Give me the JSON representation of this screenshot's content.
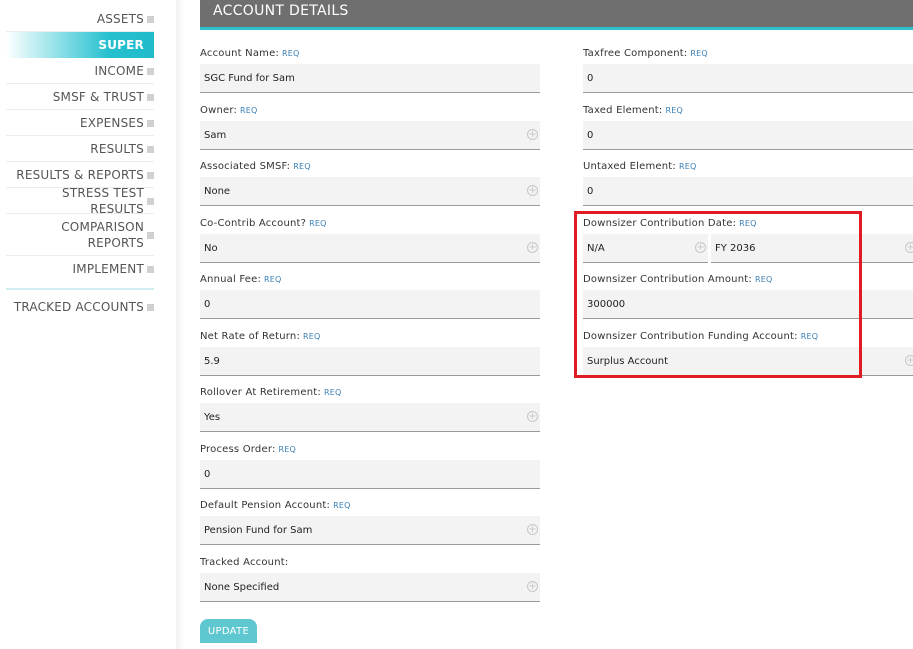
{
  "sidebar": {
    "items": [
      {
        "label": "ASSETS"
      },
      {
        "label": "SUPER"
      },
      {
        "label": "INCOME"
      },
      {
        "label": "SMSF & TRUST"
      },
      {
        "label": "EXPENSES"
      },
      {
        "label": "RESULTS"
      },
      {
        "label": "RESULTS & REPORTS"
      },
      {
        "label": "STRESS TEST RESULTS"
      },
      {
        "label_line1": "COMPARISON",
        "label_line2": "REPORTS"
      },
      {
        "label": "IMPLEMENT"
      },
      {
        "label": "TRACKED ACCOUNTS"
      }
    ],
    "active": "SUPER",
    "accent_color": "#21bccb"
  },
  "header": {
    "title": "ACCOUNT DETAILS",
    "bg_color": "#6f6f6f",
    "underline_color": "#2fc1ce"
  },
  "req_label": "REQ",
  "left_fields": [
    {
      "label": "Account Name:",
      "value": "SGC Fund for Sam",
      "req": true
    },
    {
      "label": "Owner:",
      "value": "Sam",
      "req": true
    },
    {
      "label": "Associated SMSF:",
      "value": "None",
      "req": true
    },
    {
      "label": "Co-Contrib Account?",
      "value": "No",
      "req": true
    },
    {
      "label": "Annual Fee:",
      "value": "0",
      "req": true
    },
    {
      "label": "Net Rate of Return:",
      "value": "5.9",
      "req": true
    },
    {
      "label": "Rollover At Retirement:",
      "value": "Yes",
      "req": true
    },
    {
      "label": "Process Order:",
      "value": "0",
      "req": true
    },
    {
      "label": "Default Pension Account:",
      "value": "Pension Fund for Sam",
      "req": true
    },
    {
      "label": "Tracked Account:",
      "value": "None Specified",
      "req": false
    }
  ],
  "right_fields": [
    {
      "label": "Taxfree Component:",
      "value": "0",
      "req": true
    },
    {
      "label": "Taxed Element:",
      "value": "0",
      "req": true
    },
    {
      "label": "Untaxed Element:",
      "value": "0",
      "req": true
    },
    {
      "label": "Downsizer Contribution Date:",
      "value": "N/A",
      "value2": "FY 2036",
      "req": true
    },
    {
      "label": "Downsizer Contribution Amount:",
      "value": "300000",
      "req": true
    },
    {
      "label": "Downsizer Contribution Funding Account:",
      "value": "Surplus Account",
      "req": true
    }
  ],
  "update_button": {
    "label": "UPDATE",
    "color": "#5ec7d0"
  },
  "highlight_color": "#e01b24"
}
